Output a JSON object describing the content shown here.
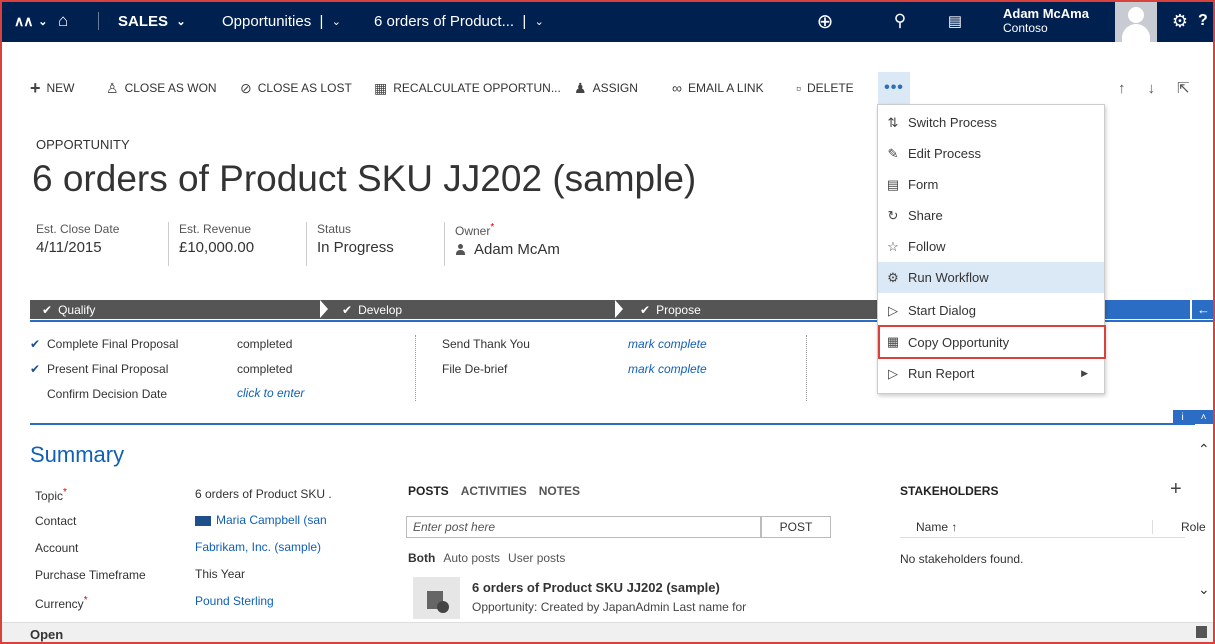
{
  "nav": {
    "logo": "∧∧",
    "area": "SALES",
    "entity": "Opportunities",
    "record": "6 orders of Product...",
    "user_name": "Adam McAma",
    "org": "Contoso",
    "help": "?"
  },
  "commands": {
    "new": "NEW",
    "close_won": "CLOSE AS WON",
    "close_lost": "CLOSE AS LOST",
    "recalc": "RECALCULATE OPPORTUN...",
    "assign": "ASSIGN",
    "email_link": "EMAIL A LINK",
    "delete": "DELETE",
    "more": "•••"
  },
  "header": {
    "entity_label": "OPPORTUNITY",
    "title": "6 orders of Product SKU JJ202 (sample)",
    "fields": [
      {
        "label": "Est. Close Date",
        "value": "4/11/2015"
      },
      {
        "label": "Est. Revenue",
        "value": "£10,000.00"
      },
      {
        "label": "Status",
        "value": "In Progress"
      },
      {
        "label": "Owner",
        "value": "Adam McAm"
      }
    ]
  },
  "process": {
    "stages": [
      "Qualify",
      "Develop",
      "Propose"
    ],
    "steps_left": [
      {
        "label": "Complete Final Proposal",
        "value": "completed",
        "done": true
      },
      {
        "label": "Present Final Proposal",
        "value": "completed",
        "done": true
      },
      {
        "label": "Confirm Decision Date",
        "value": "click to enter",
        "done": false
      }
    ],
    "steps_right": [
      {
        "label": "Send Thank You",
        "value": "mark complete"
      },
      {
        "label": "File De-brief",
        "value": "mark complete"
      }
    ]
  },
  "summary": {
    "title": "Summary",
    "fields": [
      {
        "label": "Topic",
        "value": "6 orders of Product SKU ."
      },
      {
        "label": "Contact",
        "value": "Maria Campbell (san"
      },
      {
        "label": "Account",
        "value": "Fabrikam, Inc. (sample)"
      },
      {
        "label": "Purchase Timeframe",
        "value": "This Year"
      },
      {
        "label": "Currency",
        "value": "Pound Sterling"
      }
    ]
  },
  "posts": {
    "tabs": [
      "POSTS",
      "ACTIVITIES",
      "NOTES"
    ],
    "placeholder": "Enter post here",
    "post_button": "POST",
    "filters": [
      "Both",
      "Auto posts",
      "User posts"
    ],
    "entry_title": "6 orders of Product SKU JJ202 (sample)",
    "entry_text": "Opportunity: Created by JapanAdmin Last name for"
  },
  "stakeholders": {
    "title": "STAKEHOLDERS",
    "col_name": "Name ↑",
    "col_role": "Role",
    "empty": "No stakeholders found."
  },
  "footer": {
    "status": "Open"
  },
  "menu": {
    "items": [
      "Switch Process",
      "Edit Process",
      "Form",
      "Share",
      "Follow",
      "Run Workflow",
      "Start Dialog",
      "Copy Opportunity",
      "Run Report"
    ]
  },
  "colors": {
    "nav_bg": "#002050",
    "accent": "#2b6cc4",
    "link": "#1160b7",
    "highlight_box": "#d9413c"
  }
}
